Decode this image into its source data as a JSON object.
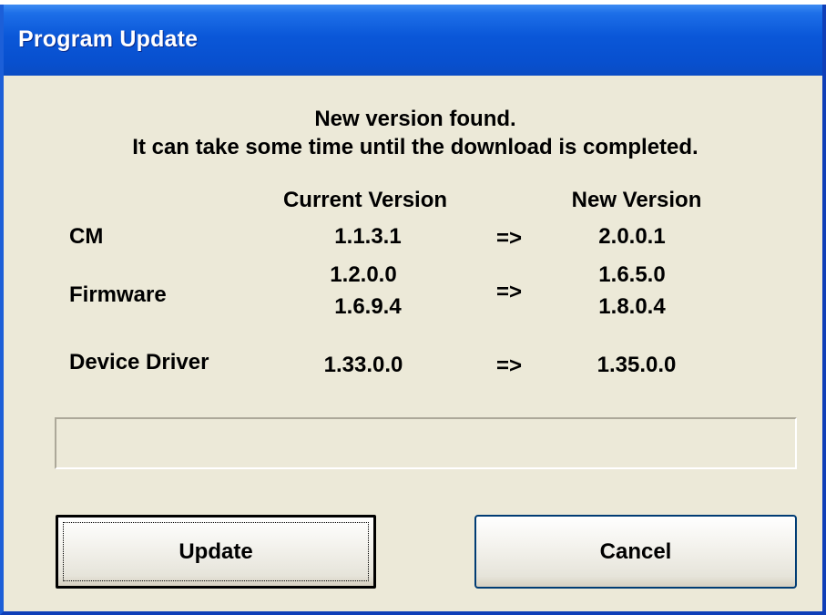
{
  "window": {
    "title": "Program Update"
  },
  "message": {
    "line1": "New version found.",
    "line2": "It can take some time until the download is completed."
  },
  "versions": {
    "header_current": "Current Version",
    "header_new": "New Version",
    "rows": [
      {
        "component": "CM",
        "current": [
          "1.1.3.1"
        ],
        "arrow": "=>",
        "new": [
          "2.0.0.1"
        ]
      },
      {
        "component": "Firmware",
        "current": [
          "1.2.0.0",
          "1.6.9.4"
        ],
        "arrow": "=>",
        "new": [
          "1.6.5.0",
          "1.8.0.4"
        ]
      },
      {
        "component": "Device Driver",
        "current": [
          "1.33.0.0"
        ],
        "arrow": "=>",
        "new": [
          "1.35.0.0"
        ]
      }
    ]
  },
  "progress": {
    "value": 0
  },
  "buttons": {
    "update_label": "Update",
    "cancel_label": "Cancel"
  },
  "colors": {
    "titlebar": "#0a57d8",
    "dialog_background": "#ece9d8",
    "button_border": "#003c74"
  }
}
